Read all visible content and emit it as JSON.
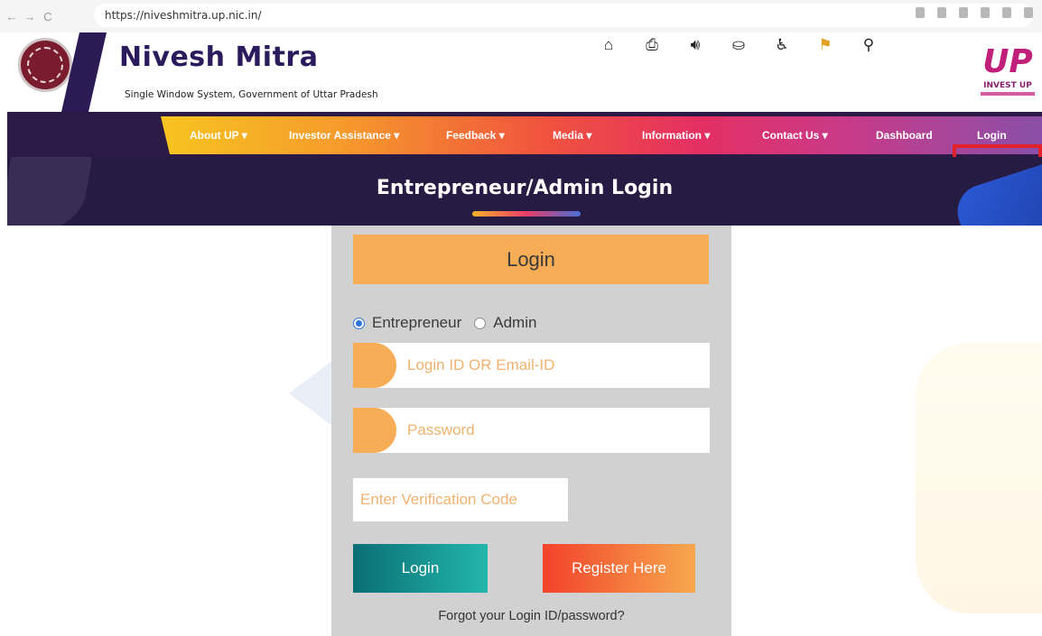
{
  "browser": {
    "url": "https://niveshmitra.up.nic.in/",
    "nav": [
      "←",
      "→",
      "C"
    ]
  },
  "header": {
    "title": "Nivesh Mitra",
    "subtitle": "Single Window System, Government of Uttar Pradesh",
    "icons": [
      "home-icon",
      "download-icon",
      "text-to-speech-icon",
      "sitemap-icon",
      "accessibility-icon",
      "language-flag-icon",
      "search-icon"
    ],
    "logo_mark": "UP",
    "logo_text": "INVEST UP"
  },
  "nav": {
    "items": [
      "About UP ▾",
      "Investor Assistance ▾",
      "Feedback ▾",
      "Media ▾",
      "Information ▾",
      "Contact Us ▾",
      "Dashboard",
      "Login"
    ],
    "highlight_color": "#e3212a"
  },
  "banner": {
    "title": "Entrepreneur/Admin Login"
  },
  "login": {
    "heading": "Login",
    "roles": [
      {
        "label": "Entrepreneur",
        "selected": true
      },
      {
        "label": "Admin",
        "selected": false
      }
    ],
    "login_id_placeholder": "Login ID OR Email-ID",
    "password_placeholder": "Password",
    "captcha_placeholder": "Enter Verification Code",
    "login_button": "Login",
    "register_button": "Register Here",
    "forgot_link": "Forgot your Login ID/password?"
  },
  "colors": {
    "accent_orange": "#f7ad55",
    "header_purple": "#2a1b5c",
    "login_teal": "#0a6f74",
    "register_orange": "#f3422b"
  }
}
